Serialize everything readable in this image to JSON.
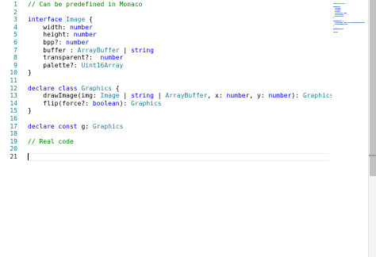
{
  "editor": {
    "lines": [
      {
        "num": "1",
        "tokens": [
          {
            "t": "// Can be predefined in Monaco",
            "c": "comment"
          }
        ]
      },
      {
        "num": "2",
        "tokens": []
      },
      {
        "num": "3",
        "tokens": [
          {
            "t": "interface ",
            "c": "keyword"
          },
          {
            "t": "Image",
            "c": "type"
          },
          {
            "t": " {",
            "c": "plain"
          }
        ]
      },
      {
        "num": "4",
        "tokens": [
          {
            "t": "    width: ",
            "c": "plain"
          },
          {
            "t": "number",
            "c": "keyword"
          }
        ]
      },
      {
        "num": "5",
        "tokens": [
          {
            "t": "    height: ",
            "c": "plain"
          },
          {
            "t": "number",
            "c": "keyword"
          }
        ]
      },
      {
        "num": "6",
        "tokens": [
          {
            "t": "    bpp?: ",
            "c": "plain"
          },
          {
            "t": "number",
            "c": "keyword"
          }
        ]
      },
      {
        "num": "7",
        "tokens": [
          {
            "t": "    buffer : ",
            "c": "plain"
          },
          {
            "t": "ArrayBuffer",
            "c": "type"
          },
          {
            "t": " | ",
            "c": "plain"
          },
          {
            "t": "string",
            "c": "keyword"
          }
        ]
      },
      {
        "num": "8",
        "tokens": [
          {
            "t": "    transparent?:  ",
            "c": "plain"
          },
          {
            "t": "number",
            "c": "keyword"
          }
        ]
      },
      {
        "num": "9",
        "tokens": [
          {
            "t": "    palette?: ",
            "c": "plain"
          },
          {
            "t": "Uint16Array",
            "c": "type"
          }
        ]
      },
      {
        "num": "10",
        "tokens": [
          {
            "t": "}",
            "c": "plain"
          }
        ]
      },
      {
        "num": "11",
        "tokens": []
      },
      {
        "num": "12",
        "tokens": [
          {
            "t": "declare ",
            "c": "keyword"
          },
          {
            "t": "class ",
            "c": "keyword"
          },
          {
            "t": "Graphics",
            "c": "type"
          },
          {
            "t": " {",
            "c": "plain"
          }
        ]
      },
      {
        "num": "13",
        "tokens": [
          {
            "t": "    drawImage(img: ",
            "c": "plain"
          },
          {
            "t": "Image",
            "c": "type"
          },
          {
            "t": " | ",
            "c": "plain"
          },
          {
            "t": "string",
            "c": "keyword"
          },
          {
            "t": " | ",
            "c": "plain"
          },
          {
            "t": "ArrayBuffer",
            "c": "type"
          },
          {
            "t": ", x: ",
            "c": "plain"
          },
          {
            "t": "number",
            "c": "keyword"
          },
          {
            "t": ", y: ",
            "c": "plain"
          },
          {
            "t": "number",
            "c": "keyword"
          },
          {
            "t": "): ",
            "c": "plain"
          },
          {
            "t": "Graphics",
            "c": "type"
          }
        ]
      },
      {
        "num": "14",
        "tokens": [
          {
            "t": "    flip(force?: ",
            "c": "plain"
          },
          {
            "t": "boolean",
            "c": "keyword"
          },
          {
            "t": "): ",
            "c": "plain"
          },
          {
            "t": "Graphics",
            "c": "type"
          }
        ]
      },
      {
        "num": "15",
        "tokens": [
          {
            "t": "}",
            "c": "plain"
          }
        ]
      },
      {
        "num": "16",
        "tokens": []
      },
      {
        "num": "17",
        "tokens": [
          {
            "t": "declare ",
            "c": "keyword"
          },
          {
            "t": "const ",
            "c": "keyword"
          },
          {
            "t": "g: ",
            "c": "plain"
          },
          {
            "t": "Graphics",
            "c": "type"
          }
        ]
      },
      {
        "num": "18",
        "tokens": []
      },
      {
        "num": "19",
        "tokens": [
          {
            "t": "// Real code",
            "c": "comment"
          }
        ]
      },
      {
        "num": "20",
        "tokens": []
      },
      {
        "num": "21",
        "tokens": []
      }
    ],
    "active_line": "21",
    "colors": {
      "comment": "#008000",
      "keyword": "#0000ff",
      "type": "#267f99",
      "line_number": "#237893",
      "line_number_active": "#0b216f"
    }
  }
}
